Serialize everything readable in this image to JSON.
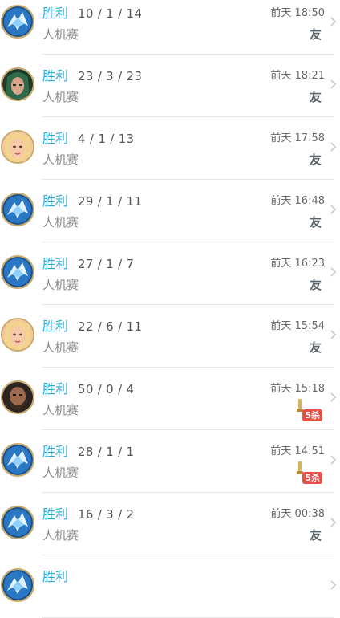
{
  "matches": [
    {
      "avatar": "avatar-ice-dragon",
      "result": "胜利",
      "kda": "10 / 1 / 14",
      "mode": "人机赛",
      "time": "前天 18:50",
      "badge": "友",
      "badge_type": "friend"
    },
    {
      "avatar": "avatar-green-haired-woman",
      "result": "胜利",
      "kda": "23 / 3 / 23",
      "mode": "人机赛",
      "time": "前天 18:21",
      "badge": "友",
      "badge_type": "friend"
    },
    {
      "avatar": "avatar-blonde-woman",
      "result": "胜利",
      "kda": "4 / 1 / 13",
      "mode": "人机赛",
      "time": "前天 17:58",
      "badge": "友",
      "badge_type": "friend"
    },
    {
      "avatar": "avatar-ice-dragon",
      "result": "胜利",
      "kda": "29 / 1 / 11",
      "mode": "人机赛",
      "time": "前天 16:48",
      "badge": "友",
      "badge_type": "friend"
    },
    {
      "avatar": "avatar-ice-dragon",
      "result": "胜利",
      "kda": "27 / 1 / 7",
      "mode": "人机赛",
      "time": "前天 16:23",
      "badge": "友",
      "badge_type": "friend"
    },
    {
      "avatar": "avatar-blonde-woman",
      "result": "胜利",
      "kda": "22 / 6 / 11",
      "mode": "人机赛",
      "time": "前天 15:54",
      "badge": "友",
      "badge_type": "friend"
    },
    {
      "avatar": "avatar-bearded-man",
      "result": "胜利",
      "kda": "50 / 0 / 4",
      "mode": "人机赛",
      "time": "前天 15:18",
      "badge": "5杀",
      "badge_type": "penta"
    },
    {
      "avatar": "avatar-ice-dragon",
      "result": "胜利",
      "kda": "28 / 1 / 1",
      "mode": "人机赛",
      "time": "前天 14:51",
      "badge": "5杀",
      "badge_type": "penta"
    },
    {
      "avatar": "avatar-ice-dragon",
      "result": "胜利",
      "kda": "16 / 3 / 2",
      "mode": "人机赛",
      "time": "前天 00:38",
      "badge": "友",
      "badge_type": "friend"
    },
    {
      "avatar": "avatar-ice-dragon",
      "result": "胜利",
      "kda": "",
      "mode": "",
      "time": "",
      "badge": "",
      "badge_type": "none"
    }
  ],
  "colors": {
    "accent": "#2aa7d6",
    "penta": "#e94d43",
    "divider": "#e6e6e6"
  }
}
